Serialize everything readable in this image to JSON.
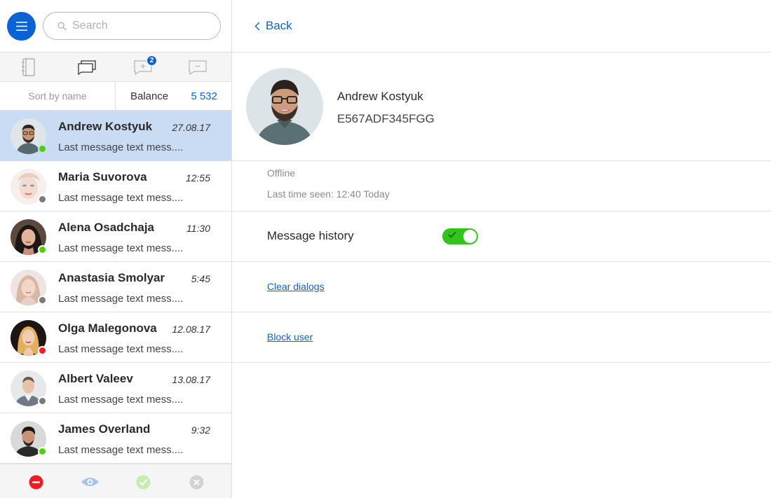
{
  "search": {
    "placeholder": "Search"
  },
  "tabs": [
    {
      "icon": "notebook-icon"
    },
    {
      "icon": "chat-bubbles-icon"
    },
    {
      "icon": "chat-add-icon",
      "badge": "2"
    },
    {
      "icon": "chat-remove-icon"
    }
  ],
  "sort": {
    "label": "Sort by name"
  },
  "balance": {
    "label": "Balance",
    "value": "5 532"
  },
  "contacts": [
    {
      "name": "Andrew Kostyuk",
      "time": "27.08.17",
      "message": "Last message text mess....",
      "status": "online",
      "status_color": "#4cd000",
      "active": true
    },
    {
      "name": "Maria Suvorova",
      "time": "12:55",
      "message": "Last message text mess....",
      "status": "offline",
      "status_color": "#7a7a7a"
    },
    {
      "name": "Alena Osadchaja",
      "time": "11:30",
      "message": "Last message text mess....",
      "status": "online",
      "status_color": "#4cd000"
    },
    {
      "name": "Anastasia Smolyar",
      "time": "5:45",
      "message": "Last message text mess....",
      "status": "offline",
      "status_color": "#7a7a7a"
    },
    {
      "name": "Olga Malegonova",
      "time": "12.08.17",
      "message": "Last message text mess....",
      "status": "busy",
      "status_color": "#f0202a"
    },
    {
      "name": "Albert Valeev",
      "time": "13.08.17",
      "message": "Last message text mess....",
      "status": "offline",
      "status_color": "#7a7a7a"
    },
    {
      "name": "James Overland",
      "time": "9:32",
      "message": "Last message text mess....",
      "status": "online",
      "status_color": "#4cd000"
    }
  ],
  "bottom_actions": [
    {
      "icon": "block-icon"
    },
    {
      "icon": "eye-icon"
    },
    {
      "icon": "check-icon"
    },
    {
      "icon": "close-icon"
    }
  ],
  "detail": {
    "back_label": "Back",
    "name": "Andrew Kostyuk",
    "id": "E567ADF345FGG",
    "status": "Offline",
    "last_seen": "Last time seen: 12:40 Today",
    "history_label": "Message history",
    "history_enabled": true,
    "clear_label": "Clear dialogs",
    "block_label": "Block user"
  },
  "colors": {
    "accent": "#0a63d6",
    "active_row": "#cadcf3",
    "toggle_on": "#32c41a"
  }
}
